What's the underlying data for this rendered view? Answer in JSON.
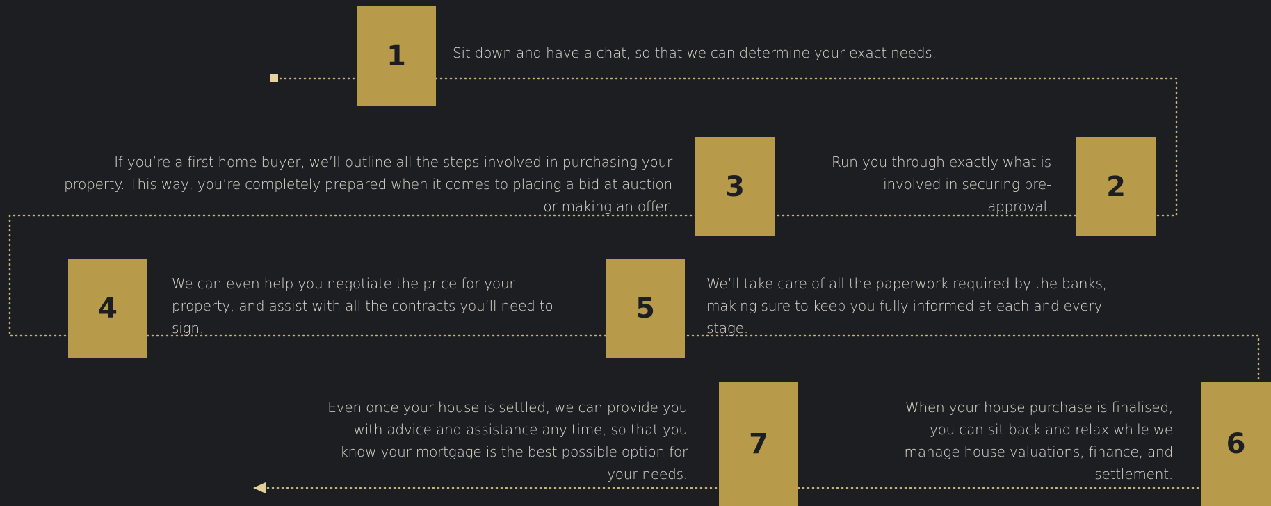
{
  "colors": {
    "background": "#1d1e22",
    "accent": "#b79b4a",
    "text": "#d9d6cc",
    "number": "#1d1e22",
    "connector": "#c9b27a"
  },
  "connector": {
    "start_marker": "square-marker",
    "end_marker": "arrowhead-left-icon",
    "style": "dotted"
  },
  "steps": [
    {
      "number": "1",
      "text": "Sit down and have a chat, so that we can determine your exact needs."
    },
    {
      "number": "2",
      "text": "Run you through exactly what is involved in securing pre-approval."
    },
    {
      "number": "3",
      "text": "If you’re a first home buyer, we’ll outline all the steps involved in purchasing your property. This way, you’re completely prepared when it comes to placing a bid at auction or making an offer."
    },
    {
      "number": "4",
      "text": "We can even help you negotiate the price for your property, and assist with all the contracts you’ll need to sign."
    },
    {
      "number": "5",
      "text": "We’ll take care of all the paperwork required by the banks, making sure to keep you fully informed at each and every stage."
    },
    {
      "number": "6",
      "text": "When your house purchase is finalised, you can sit back and relax while we manage house valuations, finance, and settlement."
    },
    {
      "number": "7",
      "text": "Even once your house is settled, we can provide you with advice and assistance any time, so that you know your mortgage is the best possible option for your needs."
    }
  ]
}
